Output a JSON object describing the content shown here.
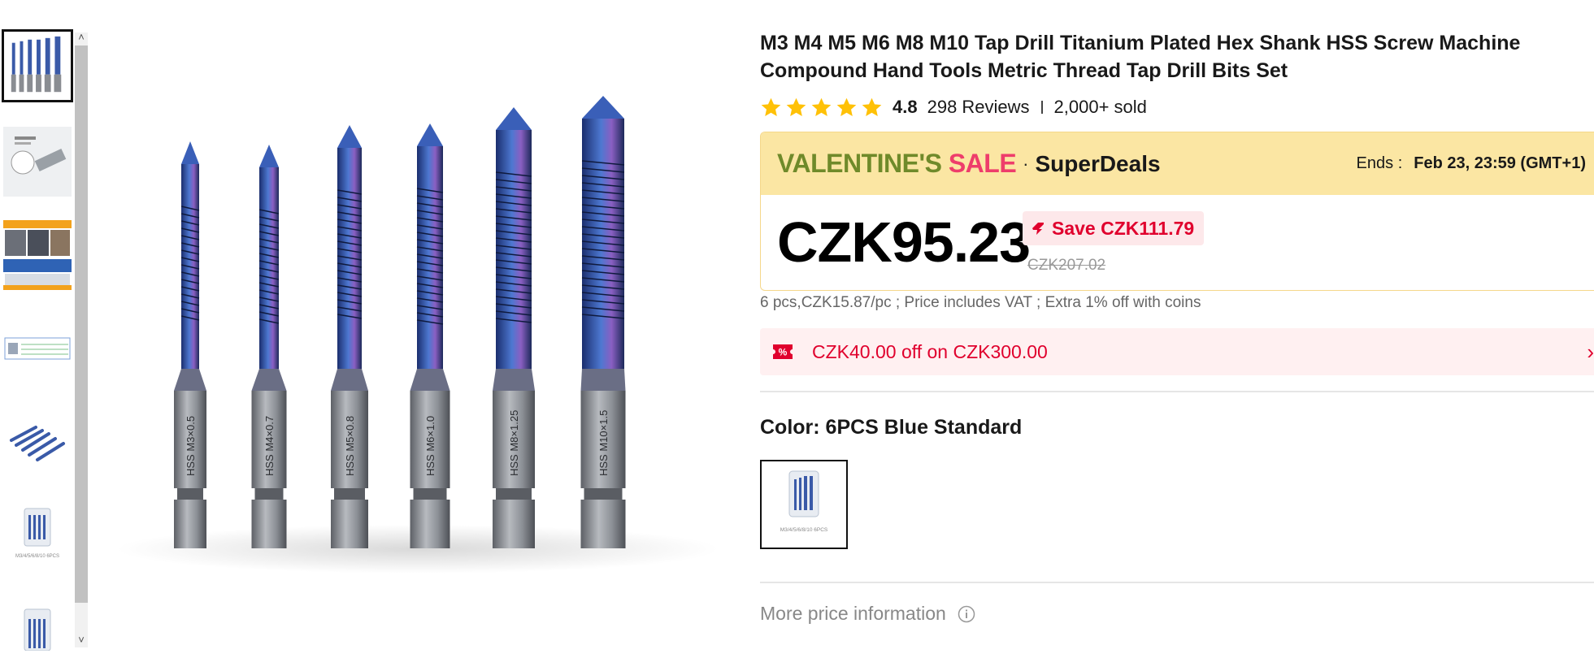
{
  "gallery": {
    "thumbnails": [
      {
        "name": "thumb-drill-set-front",
        "selected": true
      },
      {
        "name": "thumb-hex-shank-detail",
        "selected": false
      },
      {
        "name": "thumb-usage-photos",
        "selected": false
      },
      {
        "name": "thumb-size-chart",
        "selected": false
      },
      {
        "name": "thumb-drill-set-angled",
        "selected": false
      },
      {
        "name": "thumb-package-6pcs",
        "selected": false
      },
      {
        "name": "thumb-package-2",
        "selected": false
      }
    ],
    "scroll_up_glyph": "˄",
    "scroll_down_glyph": "˅",
    "main_image": {
      "drill_labels": [
        "HSS M3×0.5",
        "HSS M4×0.7",
        "HSS M5×0.8",
        "HSS M6×1.0",
        "HSS M8×1.25",
        "HSS M10×1.5"
      ]
    },
    "swatch_caption": "M3/4/5/6/8/10    6PCS"
  },
  "product": {
    "title": "M3 M4 M5 M6 M8 M10 Tap Drill Titanium Plated Hex Shank HSS Screw Machine Compound Hand Tools Metric Thread Tap Drill Bits Set",
    "rating": "4.8",
    "stars": 5,
    "reviews": "298 Reviews",
    "sold": "2,000+ sold"
  },
  "promo": {
    "sale_word_1": "VALENTINE'S",
    "sale_word_2": "SALE",
    "separator": "·",
    "brand": "SuperDeals",
    "ends_label": "Ends :",
    "ends_time": "Feb 23, 23:59 (GMT+1)",
    "price": "CZK95.23",
    "save": "Save CZK111.79",
    "old_price": "CZK207.02"
  },
  "unit_info": "6 pcs,CZK15.87/pc ; Price includes VAT ; Extra 1% off with coins",
  "coupon": {
    "text": "CZK40.00 off on CZK300.00",
    "icon_glyph": "%",
    "chevron": "›"
  },
  "color": {
    "label": "Color: 6PCS Blue Standard"
  },
  "more_price": "More price information",
  "colors": {
    "accent_red": "#e0002d",
    "promo_bg": "#fbe6a3",
    "star": "#ffc107",
    "coupon_bg": "#fff0f1"
  }
}
